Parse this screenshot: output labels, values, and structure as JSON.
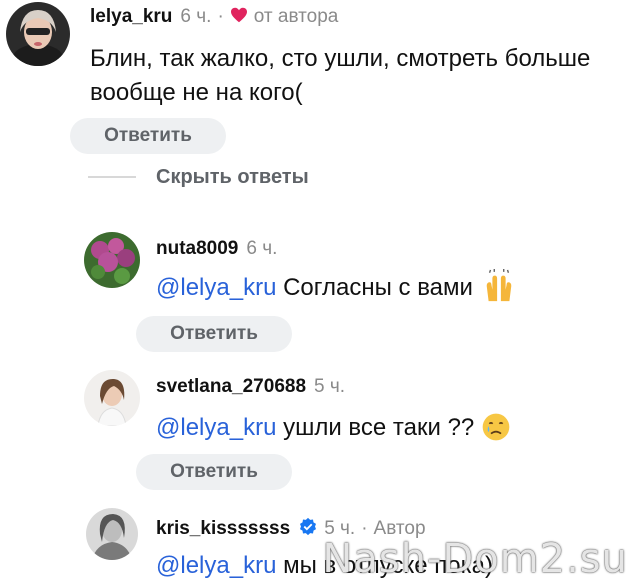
{
  "top_comment": {
    "username": "lelya_kru",
    "time": "6 ч.",
    "separator": "·",
    "author_tag": "от автора",
    "text": "Блин, так жалко, сто ушли, смотреть больше вообще не на кого(",
    "reply_label": "Ответить"
  },
  "hide_replies_label": "Скрыть ответы",
  "replies": [
    {
      "username": "nuta8009",
      "time": "6 ч.",
      "mention": "@lelya_kru",
      "text": " Согласны с вами",
      "emoji": "raising-hands-icon",
      "reply_label": "Ответить"
    },
    {
      "username": "svetlana_270688",
      "time": "5 ч.",
      "mention": "@lelya_kru",
      "text": " ушли все таки ?? ",
      "emoji": "crying-face-icon",
      "reply_label": "Ответить"
    },
    {
      "username": "kris_kisssssss",
      "time": "5 ч.",
      "separator": "·",
      "author_tag": "Автор",
      "mention": "@lelya_kru",
      "text": " мы в отпуске пока)",
      "verified": "verified-badge-icon"
    }
  ],
  "watermark": "Nash-Dom2.su",
  "colors": {
    "mention": "#2962d9",
    "heart": "#e0245e",
    "verified": "#1877f2",
    "button_bg": "#eef0f2",
    "meta": "#8a8a8a"
  }
}
